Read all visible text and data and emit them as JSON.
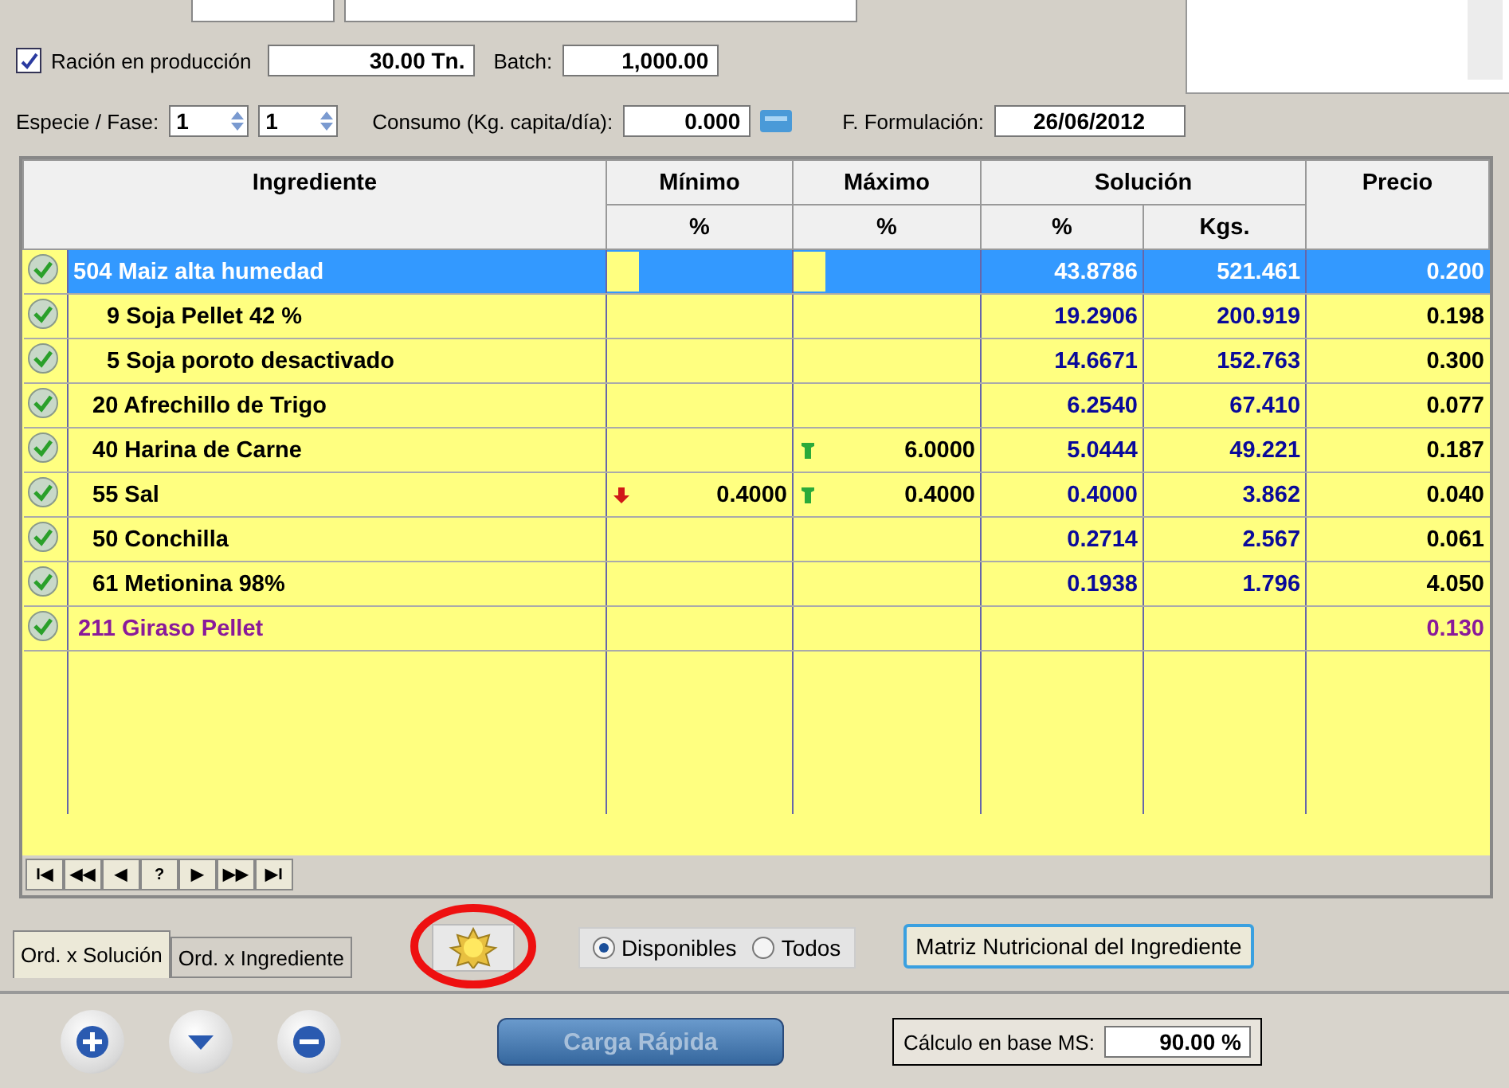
{
  "production": {
    "checked": true,
    "label": "Ración en producción",
    "amount": "30.00 Tn.",
    "batch_label": "Batch:",
    "batch": "1,000.00"
  },
  "species": {
    "label": "Especie / Fase:",
    "species_value": "1",
    "phase_value": "1",
    "consumption_label": "Consumo (Kg. capita/día):",
    "consumption": "0.000",
    "date_label": "F. Formulación:",
    "date": "26/06/2012"
  },
  "table": {
    "columns": {
      "ingredient": "Ingrediente",
      "min": "Mínimo",
      "min_unit": "%",
      "max": "Máximo",
      "max_unit": "%",
      "solution": "Solución",
      "sol_pct": "%",
      "sol_kgs": "Kgs.",
      "price": "Precio"
    },
    "rows": [
      {
        "code": "504",
        "name": "Maiz alta humedad",
        "min": "",
        "min_bound": false,
        "max": "",
        "max_bound": false,
        "pct": "43.8786",
        "kgs": "521.461",
        "price": "0.200",
        "selected": true,
        "in_solution": true
      },
      {
        "code": "9",
        "name": "Soja Pellet 42 %",
        "min": "",
        "min_bound": false,
        "max": "",
        "max_bound": false,
        "pct": "19.2906",
        "kgs": "200.919",
        "price": "0.198",
        "selected": false,
        "in_solution": true
      },
      {
        "code": "5",
        "name": "Soja poroto desactivado",
        "min": "",
        "min_bound": false,
        "max": "",
        "max_bound": false,
        "pct": "14.6671",
        "kgs": "152.763",
        "price": "0.300",
        "selected": false,
        "in_solution": true
      },
      {
        "code": "20",
        "name": "Afrechillo de Trigo",
        "min": "",
        "min_bound": false,
        "max": "",
        "max_bound": false,
        "pct": "6.2540",
        "kgs": "67.410",
        "price": "0.077",
        "selected": false,
        "in_solution": true
      },
      {
        "code": "40",
        "name": "Harina de Carne",
        "min": "",
        "min_bound": false,
        "max": "6.0000",
        "max_bound": true,
        "pct": "5.0444",
        "kgs": "49.221",
        "price": "0.187",
        "selected": false,
        "in_solution": true
      },
      {
        "code": "55",
        "name": "Sal",
        "min": "0.4000",
        "min_bound": true,
        "max": "0.4000",
        "max_bound": true,
        "pct": "0.4000",
        "kgs": "3.862",
        "price": "0.040",
        "selected": false,
        "in_solution": true
      },
      {
        "code": "50",
        "name": "Conchilla",
        "min": "",
        "min_bound": false,
        "max": "",
        "max_bound": false,
        "pct": "0.2714",
        "kgs": "2.567",
        "price": "0.061",
        "selected": false,
        "in_solution": true
      },
      {
        "code": "61",
        "name": "Metionina 98%",
        "min": "",
        "min_bound": false,
        "max": "",
        "max_bound": false,
        "pct": "0.1938",
        "kgs": "1.796",
        "price": "4.050",
        "selected": false,
        "in_solution": true
      },
      {
        "code": "211",
        "name": "Giraso Pellet",
        "min": "",
        "min_bound": false,
        "max": "",
        "max_bound": false,
        "pct": "",
        "kgs": "",
        "price": "0.130",
        "selected": false,
        "in_solution": false
      }
    ]
  },
  "navigator": [
    "I◀",
    "◀◀",
    "◀",
    "?",
    "▶",
    "▶▶",
    "▶I"
  ],
  "sort_tabs": [
    {
      "label": "Ord. x Solución",
      "selected": true
    },
    {
      "label": "Ord. x Ingrediente",
      "selected": false
    }
  ],
  "filter": [
    {
      "label": "Disponibles",
      "selected": true
    },
    {
      "label": "Todos",
      "selected": false
    }
  ],
  "matrix_button": "Matriz Nutricional del Ingrediente",
  "quick_load": {
    "label": "Carga Rápida",
    "disabled": true
  },
  "ms_basis": {
    "label": "Cálculo en base MS:",
    "value": "90.00 %"
  }
}
